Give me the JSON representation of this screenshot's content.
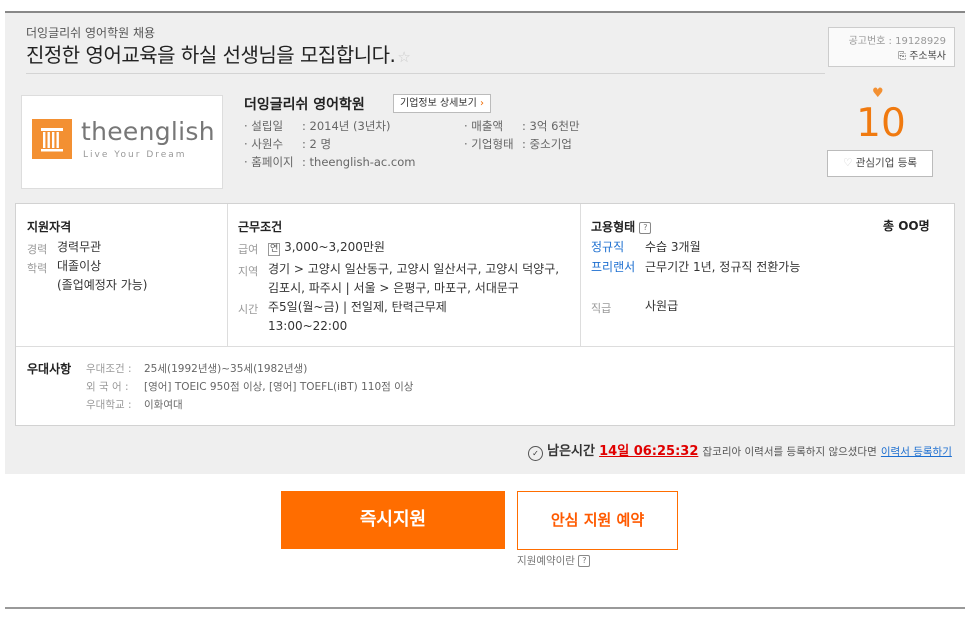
{
  "header": {
    "company_sub": "더잉글리쉬 영어학원 채용",
    "title": "진정한 영어교육을 하실 선생님을 모집합니다.",
    "star_icon": "star-icon",
    "ad_number": "공고번호 : 19128929",
    "copy_address": "주소복사"
  },
  "company": {
    "logo_main": "theenglish",
    "logo_sub": "Live Your Dream",
    "name": "더잉글리쉬 영어학원",
    "detail_btn": "기업정보 상세보기",
    "info": [
      {
        "k": "· 설립일",
        "v": ": 2014년 (3년차)"
      },
      {
        "k": "· 사원수",
        "v": ": 2 명"
      },
      {
        "k": "· 홈페이지",
        "v": ": theenglish-ac.com"
      },
      {
        "k": "· 매출액",
        "v": ": 3억 6천만"
      },
      {
        "k": "· 기업형태",
        "v": ": 중소기업"
      }
    ],
    "fav_count": "10",
    "fav_btn": "관심기업 등록"
  },
  "qualification": {
    "title": "지원자격",
    "career_label": "경력",
    "career": "경력무관",
    "edu_label": "학력",
    "edu": "대졸이상",
    "edu_note": "(졸업예정자 가능)"
  },
  "conditions": {
    "title": "근무조건",
    "salary_label": "급여",
    "salary_badge": "연",
    "salary": "3,000~3,200만원",
    "region_label": "지역",
    "region": "경기 > 고양시 일산동구, 고양시 일산서구, 고양시 덕양구, 김포시, 파주시 | 서울 > 은평구, 마포구, 서대문구",
    "time_label": "시간",
    "time1": "주5일(월~금) | 전일제, 탄력근무제",
    "time2": "13:00~22:00"
  },
  "employment": {
    "title": "고용형태",
    "total": "총 OO명",
    "type1": "정규직",
    "type1_desc": "수습 3개월",
    "type2": "프리랜서",
    "type2_desc": "근무기간 1년, 정규직 전환가능",
    "rank_label": "직급",
    "rank": "사원급"
  },
  "preference": {
    "title": "우대사항",
    "rows": [
      {
        "k": "우대조건 :",
        "v": "25세(1992년생)~35세(1982년생)"
      },
      {
        "k": "외 국 어 :",
        "v": "[영어] TOEIC 950점 이상, [영어] TOEFL(iBT) 110점 이상"
      },
      {
        "k": "우대학교 :",
        "v": "이화여대"
      }
    ]
  },
  "timer": {
    "label": "남은시간",
    "time": "14일 06:25:32",
    "note": "잡코리아 이력서를 등록하지 않으셨다면",
    "link": "이력서 등록하기"
  },
  "actions": {
    "apply": "즉시지원",
    "reserve": "안심 지원 예약",
    "reserve_help": "지원예약이란"
  },
  "colors": {
    "accent": "#ff6d00",
    "link": "#1d6fd0",
    "alert": "#e00000"
  }
}
